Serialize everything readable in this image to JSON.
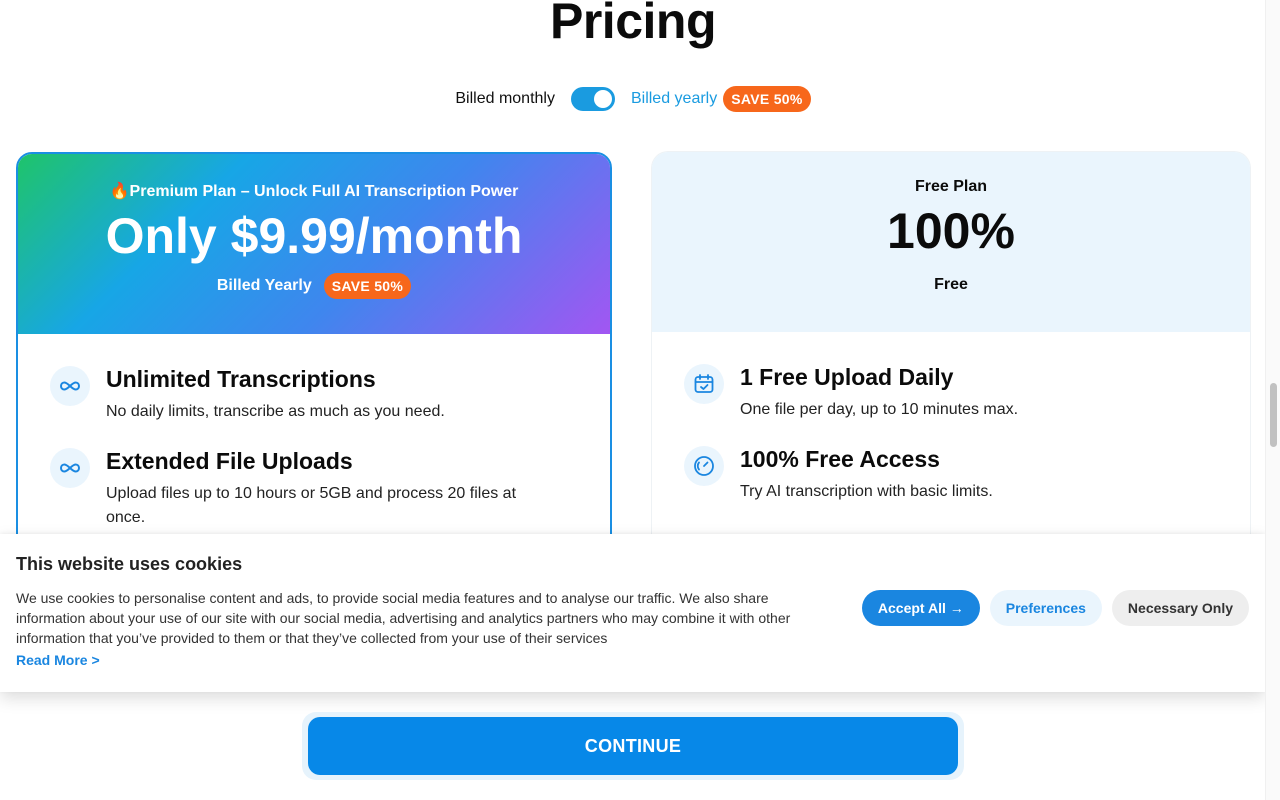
{
  "page": {
    "title": "Pricing"
  },
  "billing": {
    "monthly_label": "Billed monthly",
    "yearly_label": "Billed yearly",
    "save_badge": "SAVE 50%",
    "yearly_selected": true
  },
  "premium": {
    "plan_label": "🔥Premium Plan – Unlock Full AI Transcription Power",
    "price": "Only $9.99/month",
    "billed_label": "Billed Yearly",
    "save_badge": "SAVE 50%",
    "features": [
      {
        "icon": "infinity-icon",
        "title": "Unlimited Transcriptions",
        "desc": "No daily limits, transcribe as much as you need."
      },
      {
        "icon": "infinity-icon",
        "title": "Extended File Uploads",
        "desc": "Upload files up to 10 hours or 5GB and process 20 files at once."
      }
    ]
  },
  "free": {
    "plan_label": "Free Plan",
    "price": "100%",
    "sub": "Free",
    "features": [
      {
        "icon": "calendar-check-icon",
        "title": "1 Free Upload Daily",
        "desc": "One file per day, up to 10 minutes max."
      },
      {
        "icon": "speedometer-icon",
        "title": "100% Free Access",
        "desc": "Try AI transcription with basic limits."
      }
    ]
  },
  "cookie": {
    "title": "This website uses cookies",
    "text": "We use cookies to personalise content and ads, to provide social media features and to analyse our traffic. We also share information about your use of our site with our social media, advertising and analytics partners who may combine it with other information that you’ve provided to them or that they’ve collected from your use of their services",
    "read_more": "Read More >",
    "accept_label": "Accept All →",
    "preferences_label": "Preferences",
    "necessary_label": "Necessary Only"
  },
  "continue_label": "CONTINUE",
  "colors": {
    "accent": "#1a86e0",
    "badge": "#f7671b",
    "continue": "#0788e8"
  }
}
